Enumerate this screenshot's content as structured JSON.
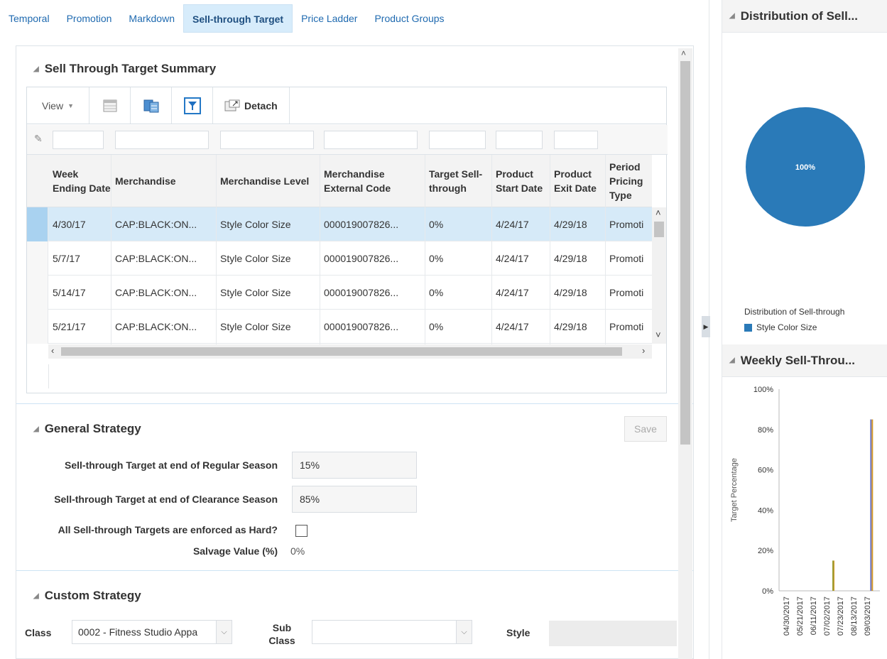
{
  "tabs": [
    "Temporal",
    "Promotion",
    "Markdown",
    "Sell-through Target",
    "Price Ladder",
    "Product Groups"
  ],
  "active_tab": "Sell-through Target",
  "summary": {
    "title": "Sell Through Target Summary",
    "toolbar": {
      "view_label": "View",
      "detach_label": "Detach"
    },
    "columns": [
      "Week Ending Date",
      "Merchandise",
      "Merchandise Level",
      "Merchandise External Code",
      "Target Sell-through",
      "Product Start Date",
      "Product Exit Date",
      "Period Pricing Type"
    ],
    "rows": [
      [
        "4/30/17",
        "CAP:BLACK:ON...",
        "Style Color Size",
        "000019007826...",
        "0%",
        "4/24/17",
        "4/29/18",
        "Promoti"
      ],
      [
        "5/7/17",
        "CAP:BLACK:ON...",
        "Style Color Size",
        "000019007826...",
        "0%",
        "4/24/17",
        "4/29/18",
        "Promoti"
      ],
      [
        "5/14/17",
        "CAP:BLACK:ON...",
        "Style Color Size",
        "000019007826...",
        "0%",
        "4/24/17",
        "4/29/18",
        "Promoti"
      ],
      [
        "5/21/17",
        "CAP:BLACK:ON...",
        "Style Color Size",
        "000019007826...",
        "0%",
        "4/24/17",
        "4/29/18",
        "Promoti"
      ]
    ]
  },
  "general": {
    "title": "General Strategy",
    "save_label": "Save",
    "regular_label": "Sell-through Target at end of Regular Season",
    "regular_value": "15%",
    "clearance_label": "Sell-through Target at end of Clearance Season",
    "clearance_value": "85%",
    "hard_label": "All Sell-through Targets are enforced as Hard?",
    "hard_checked": false,
    "salvage_label": "Salvage Value (%)",
    "salvage_value": "0%"
  },
  "custom": {
    "title": "Custom Strategy",
    "class_label": "Class",
    "class_value": "0002 - Fitness Studio Appa",
    "subclass_label_1": "Sub",
    "subclass_label_2": "Class",
    "subclass_value": "",
    "style_label": "Style"
  },
  "right_panel": {
    "dist_title": "Distribution of Sell...",
    "pie_label": "100%",
    "legend_title": "Distribution of Sell-through",
    "legend_item": "Style Color Size",
    "weekly_title": "Weekly Sell-Throu...",
    "y_axis_label": "Target Percentage"
  },
  "colors": {
    "pie": "#2a7ab8",
    "bar_a": "#9b9b2f",
    "bar_b": "#6b73c6",
    "bar_c": "#d49a2a",
    "accent": "#2478c6"
  },
  "chart_data": [
    {
      "type": "pie",
      "title": "Distribution of Sell...",
      "categories": [
        "Style Color Size"
      ],
      "values": [
        100
      ],
      "labels": [
        "100%"
      ],
      "legend_title": "Distribution of Sell-through"
    },
    {
      "type": "bar",
      "title": "Weekly Sell-Throu...",
      "ylabel": "Target Percentage",
      "y_ticks": [
        "0%",
        "20%",
        "40%",
        "60%",
        "80%",
        "100%"
      ],
      "ylim": [
        0,
        100
      ],
      "x_ticks": [
        "04/30/2017",
        "05/21/2017",
        "06/11/2017",
        "07/02/2017",
        "07/23/2017",
        "08/13/2017",
        "09/03/2017"
      ],
      "bars": [
        {
          "x": "07/12/2017",
          "value": 15
        },
        {
          "x": "09/10/2017",
          "value": 85
        }
      ]
    }
  ]
}
